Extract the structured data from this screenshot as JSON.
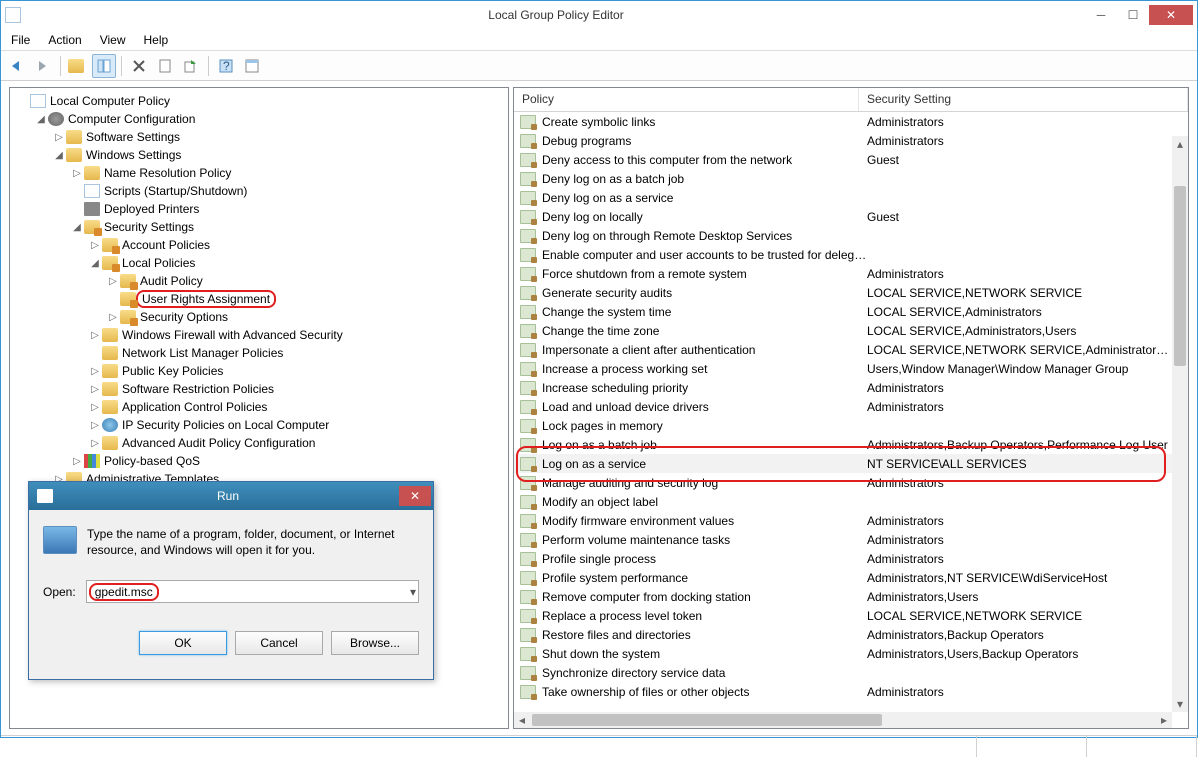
{
  "window": {
    "title": "Local Group Policy Editor"
  },
  "menu": [
    "File",
    "Action",
    "View",
    "Help"
  ],
  "tree": [
    {
      "d": 0,
      "tw": "",
      "icon": "doc",
      "label": "Local Computer Policy"
    },
    {
      "d": 1,
      "tw": "▴",
      "icon": "gear",
      "label": "Computer Configuration"
    },
    {
      "d": 2,
      "tw": "▹",
      "icon": "folder",
      "label": "Software Settings"
    },
    {
      "d": 2,
      "tw": "▴",
      "icon": "folder",
      "label": "Windows Settings"
    },
    {
      "d": 3,
      "tw": "▹",
      "icon": "folder",
      "label": "Name Resolution Policy"
    },
    {
      "d": 3,
      "tw": "",
      "icon": "doc",
      "label": "Scripts (Startup/Shutdown)"
    },
    {
      "d": 3,
      "tw": "",
      "icon": "printer",
      "label": "Deployed Printers"
    },
    {
      "d": 3,
      "tw": "▴",
      "icon": "folderlock",
      "label": "Security Settings"
    },
    {
      "d": 4,
      "tw": "▹",
      "icon": "folderlock",
      "label": "Account Policies"
    },
    {
      "d": 4,
      "tw": "▴",
      "icon": "folderlock",
      "label": "Local Policies"
    },
    {
      "d": 5,
      "tw": "▹",
      "icon": "folderlock",
      "label": "Audit Policy"
    },
    {
      "d": 5,
      "tw": "",
      "icon": "folderlock",
      "label": "User Rights Assignment",
      "hl": true
    },
    {
      "d": 5,
      "tw": "▹",
      "icon": "folderlock",
      "label": "Security Options"
    },
    {
      "d": 4,
      "tw": "▹",
      "icon": "folder",
      "label": "Windows Firewall with Advanced Security"
    },
    {
      "d": 4,
      "tw": "",
      "icon": "folder",
      "label": "Network List Manager Policies"
    },
    {
      "d": 4,
      "tw": "▹",
      "icon": "folder",
      "label": "Public Key Policies"
    },
    {
      "d": 4,
      "tw": "▹",
      "icon": "folder",
      "label": "Software Restriction Policies"
    },
    {
      "d": 4,
      "tw": "▹",
      "icon": "folder",
      "label": "Application Control Policies"
    },
    {
      "d": 4,
      "tw": "▹",
      "icon": "globe",
      "label": "IP Security Policies on Local Computer"
    },
    {
      "d": 4,
      "tw": "▹",
      "icon": "folder",
      "label": "Advanced Audit Policy Configuration"
    },
    {
      "d": 3,
      "tw": "▹",
      "icon": "bars",
      "label": "Policy-based QoS"
    },
    {
      "d": 2,
      "tw": "▹",
      "icon": "folder",
      "label": "Administrative Templates"
    }
  ],
  "columns": {
    "c1": "Policy",
    "c2": "Security Setting"
  },
  "policies": [
    {
      "p": "Create symbolic links",
      "s": "Administrators"
    },
    {
      "p": "Debug programs",
      "s": "Administrators"
    },
    {
      "p": "Deny access to this computer from the network",
      "s": "Guest"
    },
    {
      "p": "Deny log on as a batch job",
      "s": ""
    },
    {
      "p": "Deny log on as a service",
      "s": ""
    },
    {
      "p": "Deny log on locally",
      "s": "Guest"
    },
    {
      "p": "Deny log on through Remote Desktop Services",
      "s": ""
    },
    {
      "p": "Enable computer and user accounts to be trusted for delega...",
      "s": ""
    },
    {
      "p": "Force shutdown from a remote system",
      "s": "Administrators"
    },
    {
      "p": "Generate security audits",
      "s": "LOCAL SERVICE,NETWORK SERVICE"
    },
    {
      "p": "Change the system time",
      "s": "LOCAL SERVICE,Administrators"
    },
    {
      "p": "Change the time zone",
      "s": "LOCAL SERVICE,Administrators,Users"
    },
    {
      "p": "Impersonate a client after authentication",
      "s": "LOCAL SERVICE,NETWORK SERVICE,Administrators,SERV"
    },
    {
      "p": "Increase a process working set",
      "s": "Users,Window Manager\\Window Manager Group"
    },
    {
      "p": "Increase scheduling priority",
      "s": "Administrators"
    },
    {
      "p": "Load and unload device drivers",
      "s": "Administrators"
    },
    {
      "p": "Lock pages in memory",
      "s": ""
    },
    {
      "p": "Log on as a batch job",
      "s": "Administrators,Backup Operators,Performance Log User"
    },
    {
      "p": "Log on as a service",
      "s": "NT SERVICE\\ALL SERVICES",
      "sel": true
    },
    {
      "p": "Manage auditing and security log",
      "s": "Administrators"
    },
    {
      "p": "Modify an object label",
      "s": ""
    },
    {
      "p": "Modify firmware environment values",
      "s": "Administrators"
    },
    {
      "p": "Perform volume maintenance tasks",
      "s": "Administrators"
    },
    {
      "p": "Profile single process",
      "s": "Administrators"
    },
    {
      "p": "Profile system performance",
      "s": "Administrators,NT SERVICE\\WdiServiceHost"
    },
    {
      "p": "Remove computer from docking station",
      "s": "Administrators,Users"
    },
    {
      "p": "Replace a process level token",
      "s": "LOCAL SERVICE,NETWORK SERVICE"
    },
    {
      "p": "Restore files and directories",
      "s": "Administrators,Backup Operators"
    },
    {
      "p": "Shut down the system",
      "s": "Administrators,Users,Backup Operators"
    },
    {
      "p": "Synchronize directory service data",
      "s": ""
    },
    {
      "p": "Take ownership of files or other objects",
      "s": "Administrators"
    }
  ],
  "run": {
    "title": "Run",
    "msg": "Type the name of a program, folder, document, or Internet resource, and Windows will open it for you.",
    "openlabel": "Open:",
    "value": "gpedit.msc",
    "ok": "OK",
    "cancel": "Cancel",
    "browse": "Browse..."
  }
}
